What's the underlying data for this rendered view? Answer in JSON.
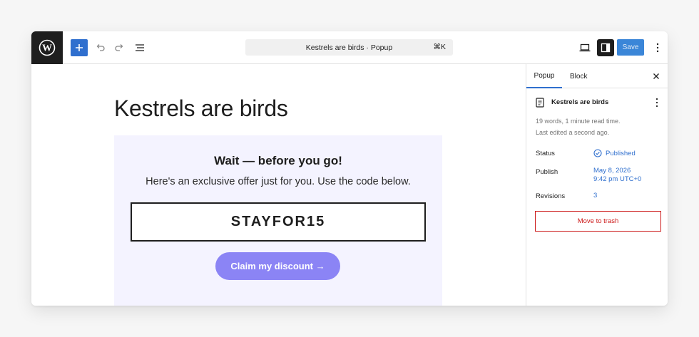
{
  "toolbar": {
    "command_bar": "Kestrels are birds · Popup",
    "shortcut": "⌘K",
    "save_label": "Save"
  },
  "canvas": {
    "post_title": "Kestrels are birds",
    "popup": {
      "heading": "Wait — before you go!",
      "text": "Here's an exclusive offer just for you. Use the code below.",
      "code": "STAYFOR15",
      "button_label": "Claim my discount →"
    }
  },
  "sidebar": {
    "tabs": [
      "Popup",
      "Block"
    ],
    "document_title": "Kestrels are birds",
    "meta_words": "19 words, 1 minute read time.",
    "meta_edited": "Last edited a second ago.",
    "status_label": "Status",
    "status_value": "Published",
    "publish_label": "Publish",
    "publish_date": "May 8, 2026",
    "publish_time": "9:42 pm UTC+0",
    "revisions_label": "Revisions",
    "revisions_value": "3",
    "trash_label": "Move to trash"
  },
  "colors": {
    "accent": "#2f6fce",
    "popup_bg": "#f4f3ff",
    "claim_button": "#8b84f5",
    "danger": "#cc1818"
  }
}
